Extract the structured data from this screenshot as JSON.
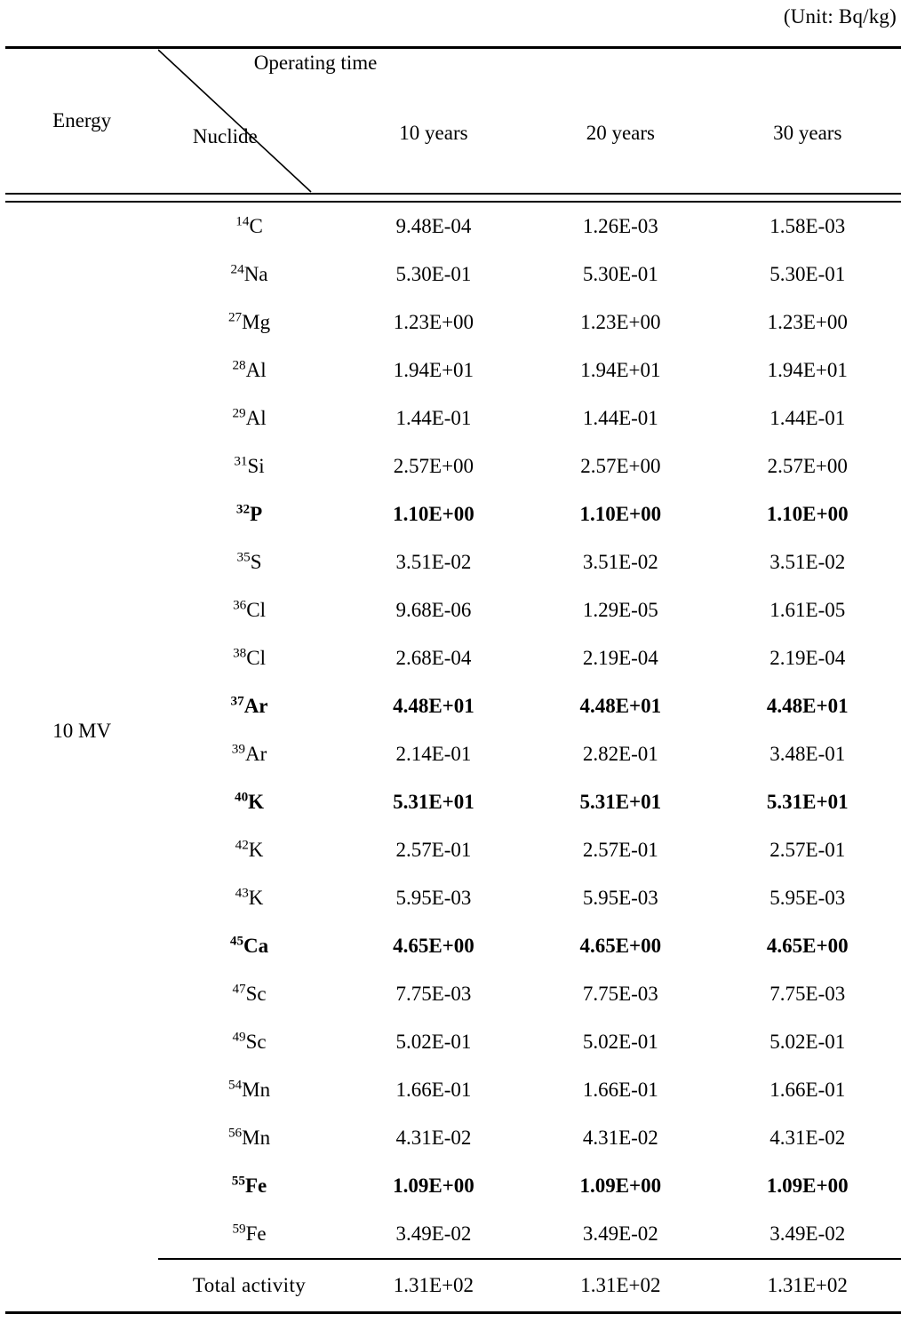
{
  "unit_caption": "(Unit:  Bq/kg)",
  "header": {
    "energy_label": "Energy",
    "operating_time_label": "Operating time",
    "nuclide_label": "Nuclide",
    "columns": [
      "10  years",
      "20  years",
      "30  years"
    ]
  },
  "energy_value": "10 MV",
  "total_label": "Total  activity",
  "chart_data": {
    "type": "table",
    "title": "Induced activity of activation nuclides at 10 MV",
    "unit": "Bq/kg",
    "row_header": "Nuclide",
    "column_header": "Operating time",
    "categories": [
      "10 years",
      "20 years",
      "30 years"
    ],
    "rows": [
      {
        "mass": "14",
        "element": "C",
        "bold": false,
        "values": [
          "9.48E-04",
          "1.26E-03",
          "1.58E-03"
        ]
      },
      {
        "mass": "24",
        "element": "Na",
        "bold": false,
        "values": [
          "5.30E-01",
          "5.30E-01",
          "5.30E-01"
        ]
      },
      {
        "mass": "27",
        "element": "Mg",
        "bold": false,
        "values": [
          "1.23E+00",
          "1.23E+00",
          "1.23E+00"
        ]
      },
      {
        "mass": "28",
        "element": "Al",
        "bold": false,
        "values": [
          "1.94E+01",
          "1.94E+01",
          "1.94E+01"
        ]
      },
      {
        "mass": "29",
        "element": "Al",
        "bold": false,
        "values": [
          "1.44E-01",
          "1.44E-01",
          "1.44E-01"
        ]
      },
      {
        "mass": "31",
        "element": "Si",
        "bold": false,
        "values": [
          "2.57E+00",
          "2.57E+00",
          "2.57E+00"
        ]
      },
      {
        "mass": "32",
        "element": "P",
        "bold": true,
        "values": [
          "1.10E+00",
          "1.10E+00",
          "1.10E+00"
        ]
      },
      {
        "mass": "35",
        "element": "S",
        "bold": false,
        "values": [
          "3.51E-02",
          "3.51E-02",
          "3.51E-02"
        ]
      },
      {
        "mass": "36",
        "element": "Cl",
        "bold": false,
        "values": [
          "9.68E-06",
          "1.29E-05",
          "1.61E-05"
        ]
      },
      {
        "mass": "38",
        "element": "Cl",
        "bold": false,
        "values": [
          "2.68E-04",
          "2.19E-04",
          "2.19E-04"
        ]
      },
      {
        "mass": "37",
        "element": "Ar",
        "bold": true,
        "values": [
          "4.48E+01",
          "4.48E+01",
          "4.48E+01"
        ]
      },
      {
        "mass": "39",
        "element": "Ar",
        "bold": false,
        "values": [
          "2.14E-01",
          "2.82E-01",
          "3.48E-01"
        ]
      },
      {
        "mass": "40",
        "element": "K",
        "bold": true,
        "values": [
          "5.31E+01",
          "5.31E+01",
          "5.31E+01"
        ]
      },
      {
        "mass": "42",
        "element": "K",
        "bold": false,
        "values": [
          "2.57E-01",
          "2.57E-01",
          "2.57E-01"
        ]
      },
      {
        "mass": "43",
        "element": "K",
        "bold": false,
        "values": [
          "5.95E-03",
          "5.95E-03",
          "5.95E-03"
        ]
      },
      {
        "mass": "45",
        "element": "Ca",
        "bold": true,
        "values": [
          "4.65E+00",
          "4.65E+00",
          "4.65E+00"
        ]
      },
      {
        "mass": "47",
        "element": "Sc",
        "bold": false,
        "values": [
          "7.75E-03",
          "7.75E-03",
          "7.75E-03"
        ]
      },
      {
        "mass": "49",
        "element": "Sc",
        "bold": false,
        "values": [
          "5.02E-01",
          "5.02E-01",
          "5.02E-01"
        ]
      },
      {
        "mass": "54",
        "element": "Mn",
        "bold": false,
        "values": [
          "1.66E-01",
          "1.66E-01",
          "1.66E-01"
        ]
      },
      {
        "mass": "56",
        "element": "Mn",
        "bold": false,
        "values": [
          "4.31E-02",
          "4.31E-02",
          "4.31E-02"
        ]
      },
      {
        "mass": "55",
        "element": "Fe",
        "bold": true,
        "values": [
          "1.09E+00",
          "1.09E+00",
          "1.09E+00"
        ]
      },
      {
        "mass": "59",
        "element": "Fe",
        "bold": false,
        "values": [
          "3.49E-02",
          "3.49E-02",
          "3.49E-02"
        ]
      }
    ],
    "total": {
      "label": "Total  activity",
      "values": [
        "1.31E+02",
        "1.31E+02",
        "1.31E+02"
      ]
    }
  }
}
